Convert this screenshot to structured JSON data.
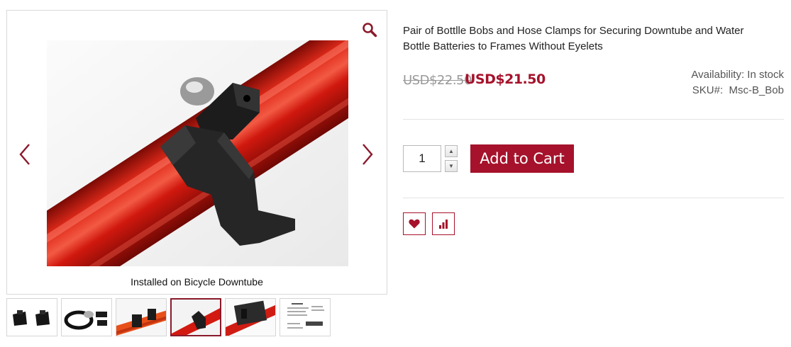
{
  "gallery": {
    "caption": "Installed on Bicycle Downtube",
    "thumbnail_count": 6,
    "active_thumbnail": 4
  },
  "product": {
    "title": "Pair of Bottlle Bobs and Hose Clamps for Securing Downtube and Water Bottle Batteries to Frames Without Eyelets",
    "old_price": "USD$22.50",
    "new_price": "USD$21.50",
    "availability": "Availability: In stock",
    "sku": "SKU#:  Msc-B_Bob"
  },
  "cart": {
    "quantity": "1",
    "add_label": "Add to Cart"
  },
  "colors": {
    "accent": "#a6122b",
    "frame_red": "#d21a10"
  },
  "icons": [
    "zoom-icon",
    "chevron-left-icon",
    "chevron-right-icon",
    "heart-icon",
    "bar-chart-icon"
  ]
}
